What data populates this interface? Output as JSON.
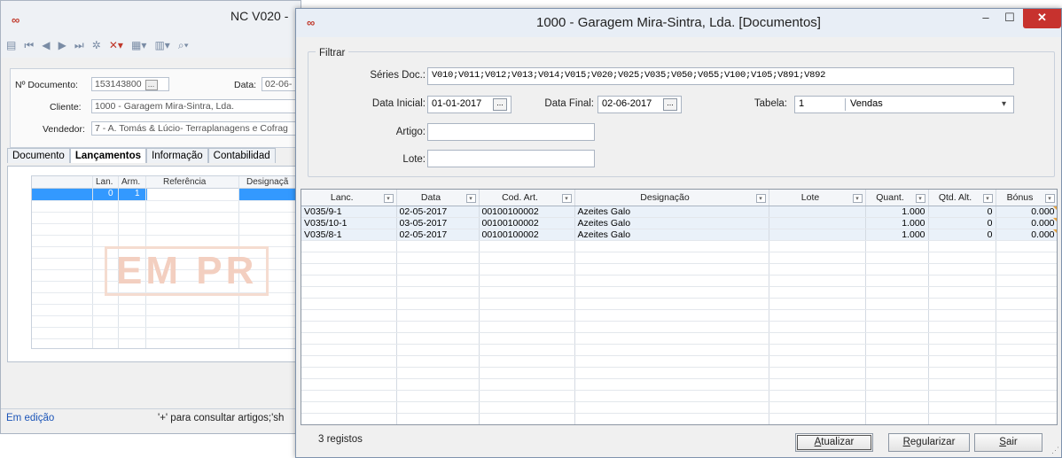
{
  "background_window": {
    "title": "NC V020 -",
    "toolbar_icons": [
      "new-doc-icon",
      "first-icon",
      "prev-icon",
      "next-icon",
      "last-icon",
      "settings-icon",
      "delete-icon",
      "insert-icon",
      "tools-icon",
      "search-icon",
      "binoculars-icon"
    ],
    "fields": {
      "doc_number_label": "Nº Documento:",
      "doc_number_value": "153143800",
      "date_label": "Data:",
      "date_value": "02-06-",
      "client_label": "Cliente:",
      "client_value": "1000 - Garagem Mira-Sintra, Lda.",
      "seller_label": "Vendedor:",
      "seller_value": "7 - A. Tomás & Lúcio- Terraplanagens e Cofrag"
    },
    "tabs": [
      "Documento",
      "Lançamentos",
      "Informação",
      "Contabilidad"
    ],
    "active_tab": "Lançamentos",
    "mini_grid": {
      "headers": [
        "Lan.",
        "Arm.",
        "Referência",
        "Designaçã"
      ],
      "selected_row": [
        "0",
        "1"
      ]
    },
    "stamp_text": "EM PR",
    "status": {
      "state": "Em edição",
      "hint": "'+' para consultar artigos;'sh"
    }
  },
  "dialog": {
    "title": "1000 - Garagem Mira-Sintra, Lda. [Documentos]",
    "window_buttons": {
      "minimize": "–",
      "maximize": "☐",
      "close": "✕"
    },
    "filter": {
      "legend": "Filtrar",
      "series_label": "Séries Doc.:",
      "series_value": "V010;V011;V012;V013;V014;V015;V020;V025;V035;V050;V055;V100;V105;V891;V892",
      "start_date_label": "Data Inicial:",
      "start_date_value": "01-01-2017",
      "end_date_label": "Data Final:",
      "end_date_value": "02-06-2017",
      "table_label": "Tabela:",
      "table_code": "1",
      "table_name": "Vendas",
      "article_label": "Artigo:",
      "article_value": "",
      "lot_label": "Lote:",
      "lot_value": ""
    },
    "grid": {
      "columns": [
        "Lanc.",
        "Data",
        "Cod. Art.",
        "Designação",
        "Lote",
        "Quant.",
        "Qtd. Alt.",
        "Bónus"
      ],
      "rows": [
        [
          "V035/9-1",
          "02-05-2017",
          "00100100002",
          "Azeites Galo",
          "",
          "1.000",
          "0",
          "0.000"
        ],
        [
          "V035/10-1",
          "03-05-2017",
          "00100100002",
          "Azeites Galo",
          "",
          "1.000",
          "0",
          "0.000"
        ],
        [
          "V035/8-1",
          "02-05-2017",
          "00100100002",
          "Azeites Galo",
          "",
          "1.000",
          "0",
          "0.000"
        ]
      ]
    },
    "record_count": "3 registos",
    "buttons": {
      "refresh_first": "A",
      "refresh_rest": "tualizar",
      "regularize_first": "R",
      "regularize_rest": "egularizar",
      "exit_first": "S",
      "exit_rest": "air"
    }
  }
}
